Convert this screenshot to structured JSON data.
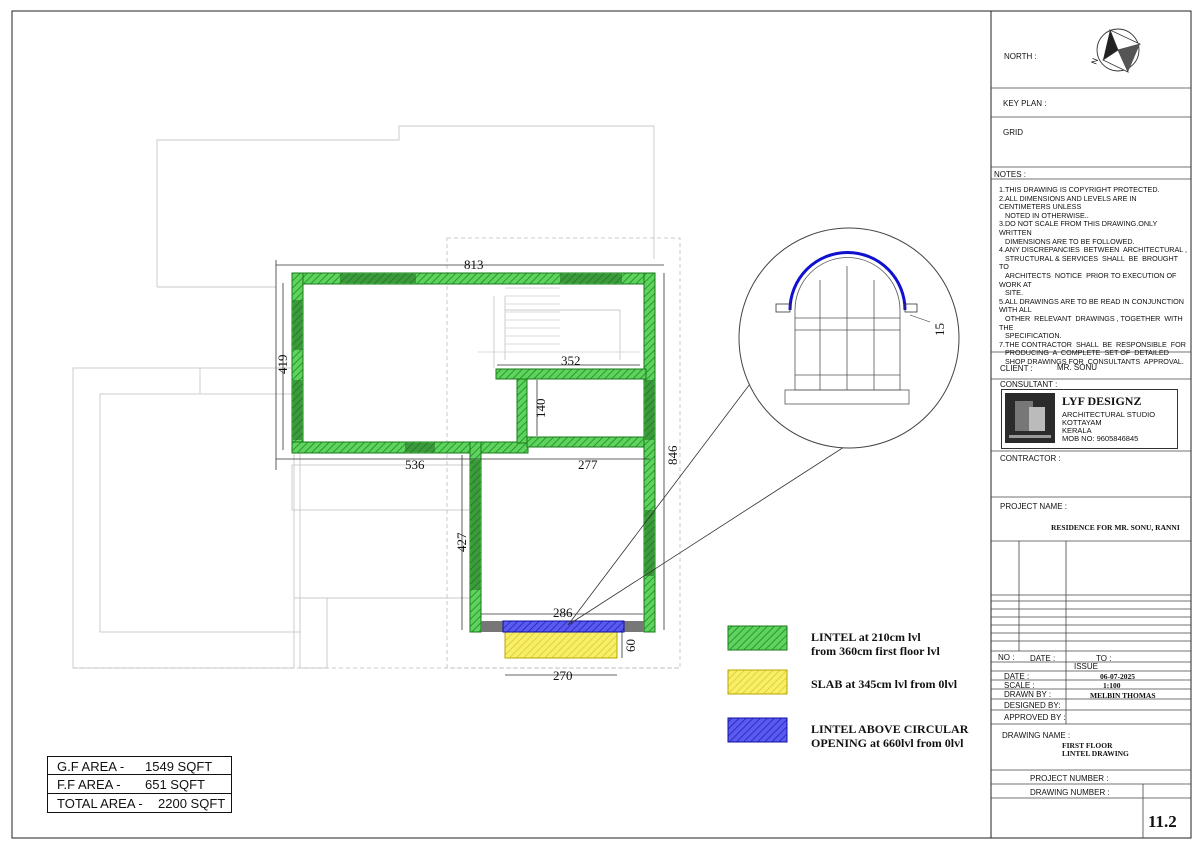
{
  "title_block": {
    "north_label": "NORTH :",
    "north_arrow_letter": "N",
    "key_plan_label": "KEY PLAN :",
    "grid_label": "GRID",
    "notes_label": "NOTES :",
    "notes": [
      "1.THIS DRAWING IS COPYRIGHT PROTECTED.",
      "2.ALL DIMENSIONS AND LEVELS ARE IN CENTIMETERS UNLESS",
      "   NOTED IN OTHERWISE..",
      "3.DO NOT SCALE FROM THIS DRAWING.ONLY WRITTEN",
      "   DIMENSIONS ARE TO BE FOLLOWED.",
      "4.ANY DISCREPANCIES  BETWEEN  ARCHITECTURAL ,",
      "   STRUCTURAL & SERVICES  SHALL  BE  BROUGHT  TO",
      "   ARCHITECTS  NOTICE  PRIOR TO EXECUTION OF WORK AT",
      "   SITE.",
      "5.ALL DRAWINGS ARE TO BE READ IN CONJUNCTION WITH ALL",
      "   OTHER  RELEVANT  DRAWINGS , TOGETHER  WITH  THE",
      "   SPECIFICATION.",
      "7.THE CONTRACTOR  SHALL  BE  RESPONSIBLE  FOR",
      "   PRODUCING  A  COMPLETE  SET OF  DETAILED",
      "   SHOP DRAWINGS FOR  CONSULTANTS  APPROVAL."
    ],
    "client_label": "CLIENT :",
    "client_value": "MR. SONU",
    "consultant_label": "CONSULTANT :",
    "firm_name": "LYF DESIGNZ",
    "firm_lines": [
      "ARCHITECTURAL STUDIO",
      "KOTTAYAM",
      "KERALA",
      "MOB NO: 9605846845"
    ],
    "contractor_label": "CONTRACTOR :",
    "project_name_label": "PROJECT NAME :",
    "project_name_value": "RESIDENCE FOR  MR. SONU, RANNI",
    "no_label": "NO :",
    "date_col_label": "DATE :",
    "to_label": "TO :",
    "issue_label": "ISSUE",
    "date_label": "DATE :",
    "date_value": "06-07-2025",
    "scale_label": "SCALE :",
    "scale_value": "1:100",
    "drawn_by_label": "DRAWN BY :",
    "drawn_by_value": "MELBIN THOMAS",
    "designed_by_label": "DESIGNED BY:",
    "approved_by_label": "APPROVED BY :",
    "drawing_name_label": "DRAWING NAME :",
    "drawing_name_1": "FIRST FLOOR",
    "drawing_name_2": "LINTEL DRAWING",
    "project_number_label": "PROJECT NUMBER :",
    "drawing_number_label": "DRAWING NUMBER :",
    "sheet_number": "11.2"
  },
  "dimensions": {
    "top_width": "813",
    "left_height": "419",
    "inner_352": "352",
    "inner_140": "140",
    "dim_536": "536",
    "dim_277": "277",
    "dim_846": "846",
    "dim_427": "427",
    "dim_286": "286",
    "dim_270": "270",
    "dim_60": "60",
    "detail_15": "15"
  },
  "legend": [
    {
      "line1": "LINTEL at 210cm lvl",
      "line2": "from  360cm first floor lvl",
      "color": "#3cc43c"
    },
    {
      "line1": "SLAB at 345cm lvl from 0lvl",
      "line2": "",
      "color": "#f2e85a"
    },
    {
      "line1": "LINTEL ABOVE CIRCULAR",
      "line2": "OPENING at 660lvl from 0lvl",
      "color": "#3a3ae0"
    }
  ],
  "areas": [
    {
      "label": "G.F AREA -",
      "value": "1549 SQFT"
    },
    {
      "label": "F.F AREA -",
      "value": "651 SQFT"
    },
    {
      "label": "TOTAL AREA -",
      "value": "2200 SQFT"
    }
  ]
}
